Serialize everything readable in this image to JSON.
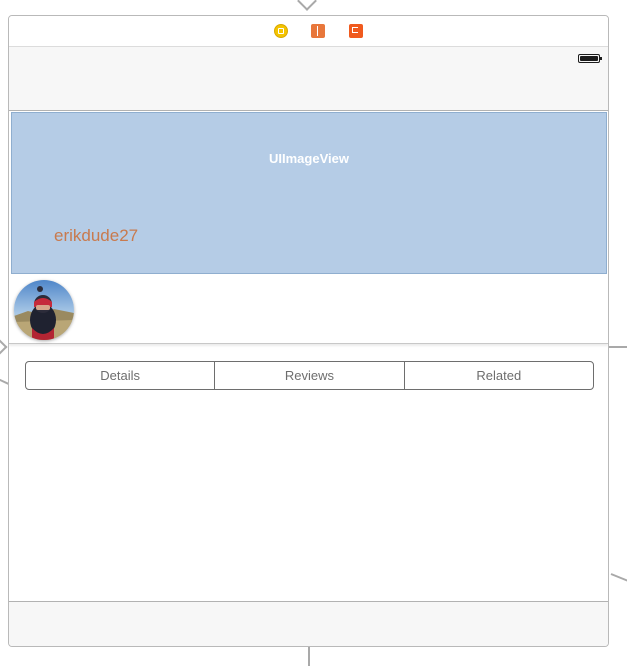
{
  "scene_dock": {
    "icons": [
      "view-controller-icon",
      "first-responder-icon",
      "exit-icon"
    ],
    "colors": {
      "view_controller": "#f4c400",
      "first_responder": "#e8773b",
      "exit": "#f05a1e"
    }
  },
  "status_bar": {
    "battery_icon": "battery-full-icon"
  },
  "image_view": {
    "label": "UIImageView",
    "background_color": "#b5cce6"
  },
  "profile": {
    "username": "erikdude27",
    "username_color": "#c87a4e",
    "avatar_icon": "avatar-photo"
  },
  "segmented_control": {
    "segments": [
      {
        "label": "Details"
      },
      {
        "label": "Reviews"
      },
      {
        "label": "Related"
      }
    ]
  },
  "tab_bar": {
    "background_color": "#f7f7f7"
  }
}
